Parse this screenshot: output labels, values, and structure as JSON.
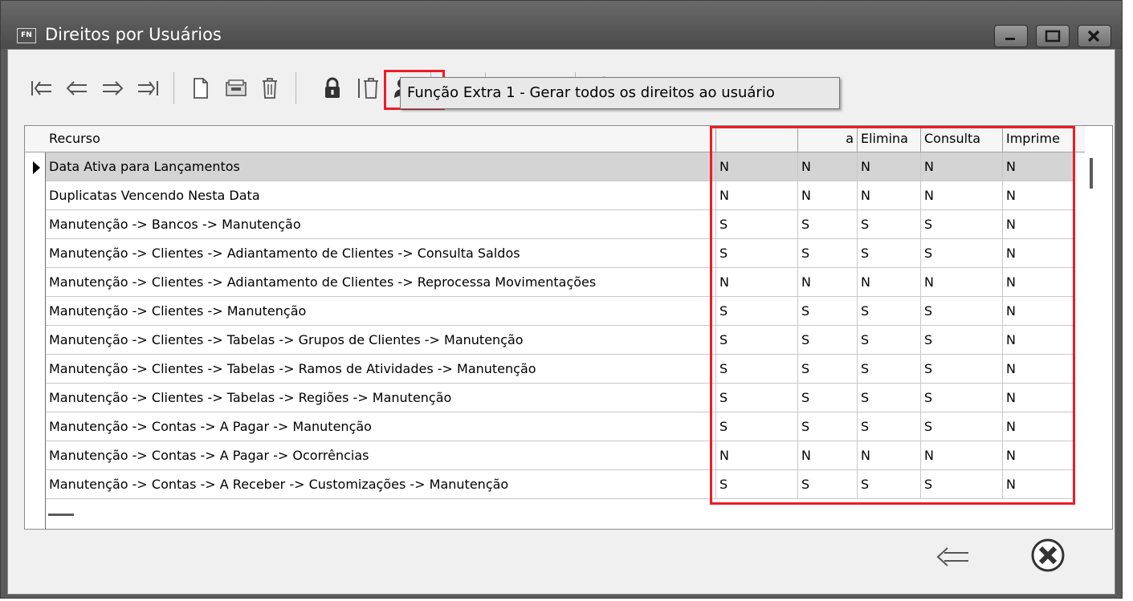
{
  "window": {
    "icon_text": "FN",
    "title": "Direitos por Usuários"
  },
  "toolbar": {
    "tooltip": "Função Extra 1 - Gerar todos os direitos ao usuário",
    "buttons": [
      "first-record",
      "previous-record",
      "next-record",
      "last-record",
      "new-document",
      "open-folder",
      "delete-trash",
      "lock",
      "delete-all",
      "user-settings",
      "edit",
      "pdf",
      "excel",
      "cancel"
    ]
  },
  "grid": {
    "columns": [
      "Recurso",
      "",
      "a",
      "Elimina",
      "Consulta",
      "Imprime"
    ],
    "rows": [
      {
        "recurso": "Data Ativa para Lançamentos",
        "c1": "N",
        "c2": "N",
        "c3": "N",
        "c4": "N",
        "c5": "N"
      },
      {
        "recurso": "Duplicatas Vencendo Nesta Data",
        "c1": "N",
        "c2": "N",
        "c3": "N",
        "c4": "N",
        "c5": "N"
      },
      {
        "recurso": "Manutenção -> Bancos -> Manutenção",
        "c1": "S",
        "c2": "S",
        "c3": "S",
        "c4": "S",
        "c5": "N"
      },
      {
        "recurso": "Manutenção -> Clientes -> Adiantamento de Clientes -> Consulta Saldos",
        "c1": "S",
        "c2": "S",
        "c3": "S",
        "c4": "S",
        "c5": "N"
      },
      {
        "recurso": "Manutenção -> Clientes -> Adiantamento de Clientes -> Reprocessa Movimentações",
        "c1": "N",
        "c2": "N",
        "c3": "N",
        "c4": "N",
        "c5": "N"
      },
      {
        "recurso": "Manutenção -> Clientes -> Manutenção",
        "c1": "S",
        "c2": "S",
        "c3": "S",
        "c4": "S",
        "c5": "N"
      },
      {
        "recurso": "Manutenção -> Clientes -> Tabelas -> Grupos de Clientes -> Manutenção",
        "c1": "S",
        "c2": "S",
        "c3": "S",
        "c4": "S",
        "c5": "N"
      },
      {
        "recurso": "Manutenção -> Clientes -> Tabelas -> Ramos de Atividades -> Manutenção",
        "c1": "S",
        "c2": "S",
        "c3": "S",
        "c4": "S",
        "c5": "N"
      },
      {
        "recurso": "Manutenção -> Clientes -> Tabelas -> Regiões -> Manutenção",
        "c1": "S",
        "c2": "S",
        "c3": "S",
        "c4": "S",
        "c5": "N"
      },
      {
        "recurso": "Manutenção -> Contas -> A Pagar -> Manutenção",
        "c1": "S",
        "c2": "S",
        "c3": "S",
        "c4": "S",
        "c5": "N"
      },
      {
        "recurso": "Manutenção -> Contas -> A Pagar -> Ocorrências",
        "c1": "N",
        "c2": "N",
        "c3": "N",
        "c4": "N",
        "c5": "N"
      },
      {
        "recurso": "Manutenção -> Contas -> A Receber -> Customizações -> Manutenção",
        "c1": "S",
        "c2": "S",
        "c3": "S",
        "c4": "S",
        "c5": "N"
      }
    ]
  },
  "colors": {
    "highlight": "#ee1c25",
    "titlebar": "#5a5a5a"
  }
}
